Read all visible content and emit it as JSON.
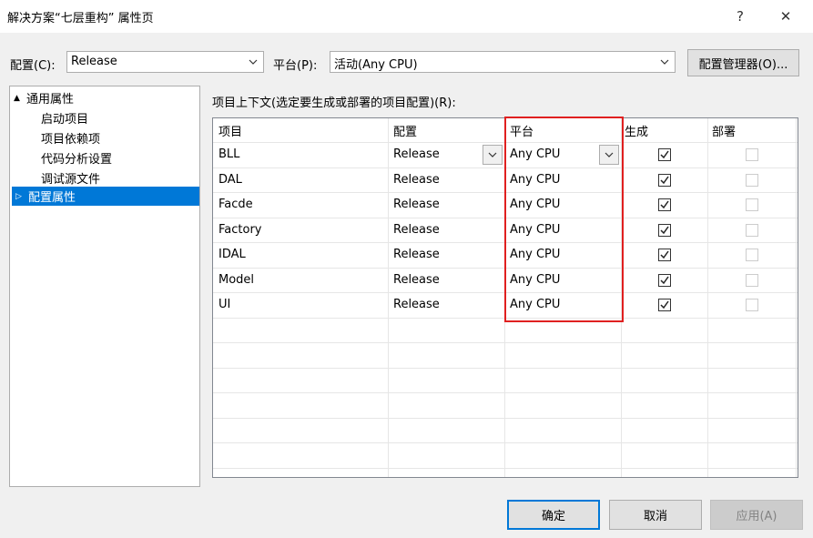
{
  "window": {
    "title": "解决方案“七层重构” 属性页",
    "help_label": "?",
    "close_label": "✕"
  },
  "config_bar": {
    "config_label": "配置(C):",
    "config_value": "Release",
    "platform_label": "平台(P):",
    "platform_value": "活动(Any CPU)",
    "manager_button": "配置管理器(O)..."
  },
  "tree": {
    "common_label": "通用属性",
    "common_children": [
      "启动项目",
      "项目依赖项",
      "代码分析设置",
      "调试源文件"
    ],
    "config_props_label": "配置属性"
  },
  "grid_caption": "项目上下文(选定要生成或部署的项目配置)(R):",
  "columns": {
    "project": "项目",
    "config": "配置",
    "platform": "平台",
    "build": "生成",
    "deploy": "部署"
  },
  "rows": [
    {
      "project": "BLL",
      "config": "Release",
      "platform": "Any CPU",
      "build": true,
      "deploy": false
    },
    {
      "project": "DAL",
      "config": "Release",
      "platform": "Any CPU",
      "build": true,
      "deploy": false
    },
    {
      "project": "Facde",
      "config": "Release",
      "platform": "Any CPU",
      "build": true,
      "deploy": false
    },
    {
      "project": "Factory",
      "config": "Release",
      "platform": "Any CPU",
      "build": true,
      "deploy": false
    },
    {
      "project": "IDAL",
      "config": "Release",
      "platform": "Any CPU",
      "build": true,
      "deploy": false
    },
    {
      "project": "Model",
      "config": "Release",
      "platform": "Any CPU",
      "build": true,
      "deploy": false
    },
    {
      "project": "UI",
      "config": "Release",
      "platform": "Any CPU",
      "build": true,
      "deploy": false
    }
  ],
  "buttons": {
    "ok": "确定",
    "cancel": "取消",
    "apply": "应用(A)"
  },
  "colors": {
    "selection": "#0078d7",
    "highlight_box": "#e02020"
  }
}
